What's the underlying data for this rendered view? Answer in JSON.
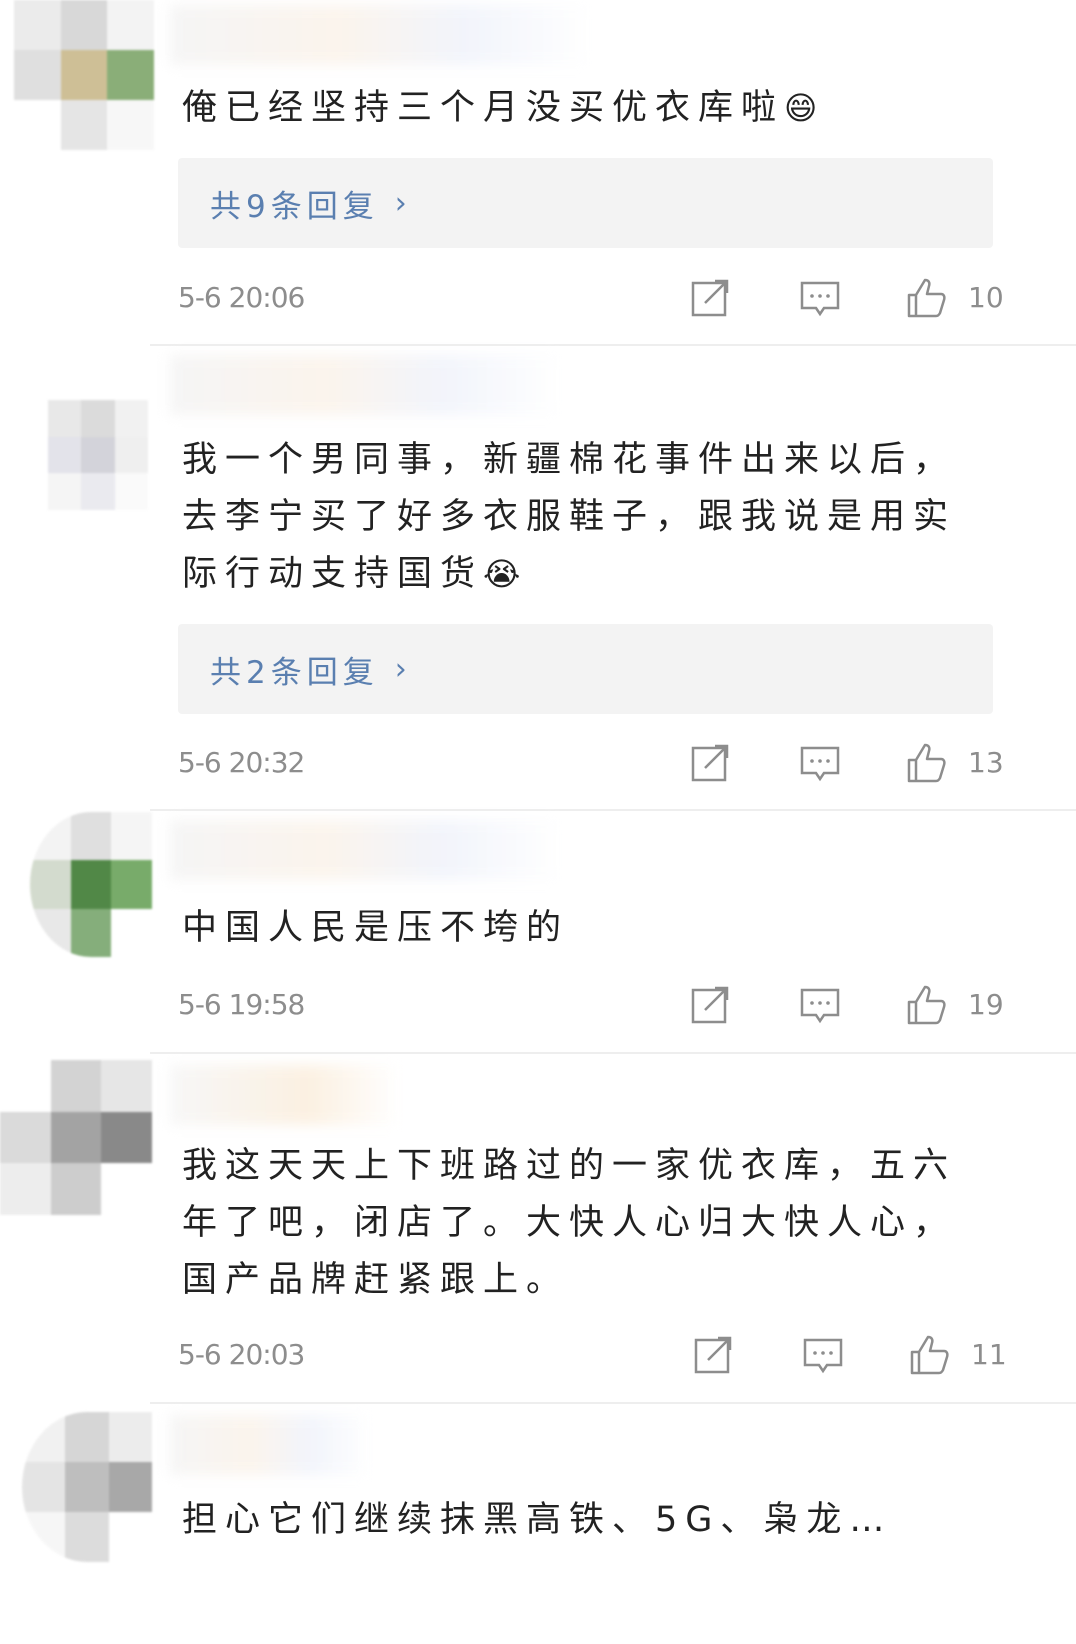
{
  "comments": [
    {
      "text": "俺已经坚持三个月没买优衣库啦",
      "emoji": "😄",
      "replies_label": "共9条回复",
      "time": "5-6 20:06",
      "likes": "10"
    },
    {
      "text": "我一个男同事，新疆棉花事件出来以后，去李宁买了好多衣服鞋子，跟我说是用实际行动支持国货",
      "emoji": "😭",
      "replies_label": "共2条回复",
      "time": "5-6 20:32",
      "likes": "13"
    },
    {
      "text": "中国人民是压不垮的",
      "time": "5-6 19:58",
      "likes": "19"
    },
    {
      "text": "我这天天上下班路过的一家优衣库，五六年了吧，闭店了。大快人心归大快人心，国产品牌赶紧跟上。",
      "time": "5-6 20:03",
      "likes": "11"
    },
    {
      "text": "担心它们继续抹黑高铁、5G、枭龙…"
    }
  ],
  "icons": {
    "share": "share-icon",
    "comment": "comment-icon",
    "like": "thumbs-up-icon",
    "reply_more": "chevron-right-icon"
  },
  "colors": {
    "text": "#222222",
    "meta": "#8d8d8d",
    "link": "#5a7fb0",
    "reply_bg": "#f3f3f3"
  }
}
